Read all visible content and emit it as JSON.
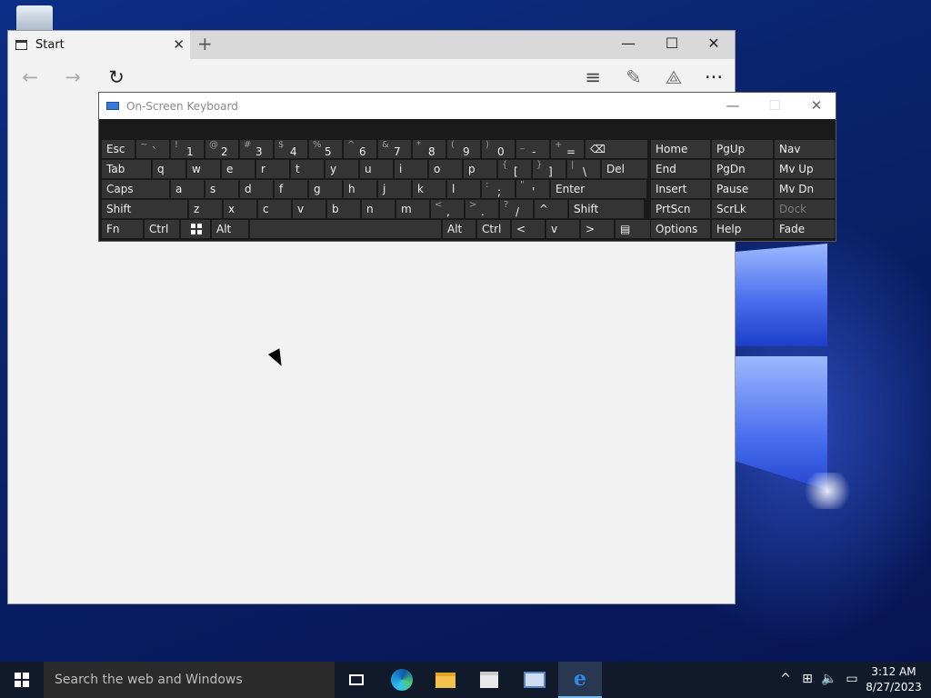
{
  "browser": {
    "tab_title": "Start",
    "tab_close": "✕",
    "new_tab": "+",
    "minimize": "—",
    "maximize": "☐",
    "close": "✕",
    "icons": {
      "back": "←",
      "forward": "→",
      "refresh": "↻",
      "hub": "≡",
      "note": "✎",
      "share": "⟁",
      "more": "···"
    }
  },
  "osk": {
    "title": "On-Screen Keyboard",
    "minimize": "—",
    "maximize": "☐",
    "close": "✕",
    "row1": [
      {
        "label": "Esc"
      },
      {
        "shift": "~",
        "main": "`"
      },
      {
        "shift": "!",
        "main": "1"
      },
      {
        "shift": "@",
        "main": "2"
      },
      {
        "shift": "#",
        "main": "3"
      },
      {
        "shift": "$",
        "main": "4"
      },
      {
        "shift": "%",
        "main": "5"
      },
      {
        "shift": "^",
        "main": "6"
      },
      {
        "shift": "&",
        "main": "7"
      },
      {
        "shift": "*",
        "main": "8"
      },
      {
        "shift": "(",
        "main": "9"
      },
      {
        "shift": ")",
        "main": "0"
      },
      {
        "shift": "_",
        "main": "-"
      },
      {
        "shift": "+",
        "main": "="
      },
      {
        "label": "⌫"
      }
    ],
    "row2": [
      {
        "label": "Tab"
      },
      {
        "label": "q"
      },
      {
        "label": "w"
      },
      {
        "label": "e"
      },
      {
        "label": "r"
      },
      {
        "label": "t"
      },
      {
        "label": "y"
      },
      {
        "label": "u"
      },
      {
        "label": "i"
      },
      {
        "label": "o"
      },
      {
        "label": "p"
      },
      {
        "shift": "{",
        "main": "["
      },
      {
        "shift": "}",
        "main": "]"
      },
      {
        "shift": "|",
        "main": "\\"
      },
      {
        "label": "Del"
      }
    ],
    "row3": [
      {
        "label": "Caps"
      },
      {
        "label": "a"
      },
      {
        "label": "s"
      },
      {
        "label": "d"
      },
      {
        "label": "f"
      },
      {
        "label": "g"
      },
      {
        "label": "h"
      },
      {
        "label": "j"
      },
      {
        "label": "k"
      },
      {
        "label": "l"
      },
      {
        "shift": ":",
        "main": ";"
      },
      {
        "shift": "\"",
        "main": "'"
      },
      {
        "label": "Enter"
      }
    ],
    "row4": [
      {
        "label": "Shift"
      },
      {
        "label": "z"
      },
      {
        "label": "x"
      },
      {
        "label": "c"
      },
      {
        "label": "v"
      },
      {
        "label": "b"
      },
      {
        "label": "n"
      },
      {
        "label": "m"
      },
      {
        "shift": "<",
        "main": ","
      },
      {
        "shift": ">",
        "main": "."
      },
      {
        "shift": "?",
        "main": "/"
      },
      {
        "label": "^"
      },
      {
        "label": "Shift"
      }
    ],
    "row5": [
      {
        "label": "Fn"
      },
      {
        "label": "Ctrl"
      },
      {
        "label": "win"
      },
      {
        "label": "Alt"
      },
      {
        "label": ""
      },
      {
        "label": "Alt"
      },
      {
        "label": "Ctrl"
      },
      {
        "label": "<"
      },
      {
        "label": "v"
      },
      {
        "label": ">"
      },
      {
        "label": "▤"
      }
    ],
    "nav": [
      [
        "Home",
        "PgUp",
        "Nav"
      ],
      [
        "End",
        "PgDn",
        "Mv Up"
      ],
      [
        "Insert",
        "Pause",
        "Mv Dn"
      ],
      [
        "PrtScn",
        "ScrLk",
        "Dock"
      ],
      [
        "Options",
        "Help",
        "Fade"
      ]
    ]
  },
  "taskbar": {
    "search_placeholder": "Search the web and Windows",
    "time": "3:12 AM",
    "date": "8/27/2023",
    "tray": {
      "chevron": "^",
      "network": "⊞",
      "volume": "🔈",
      "notifications": "▭"
    }
  }
}
